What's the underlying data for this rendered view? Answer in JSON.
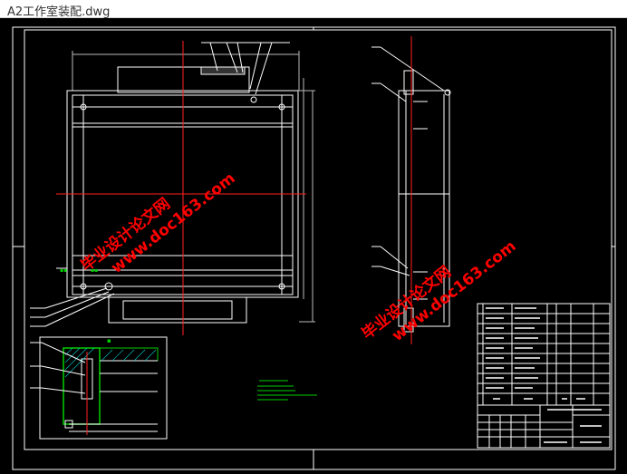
{
  "window": {
    "title": "A2工作室装配.dwg"
  },
  "watermarks": [
    {
      "line1": "毕业设计论文网",
      "line2": "www.doc163.com"
    },
    {
      "line1": "毕业设计论文网",
      "line2": "www.doc163.com"
    }
  ],
  "colors": {
    "background": "#000000",
    "drawing": "#ffffff",
    "centerline": "#ff2020",
    "section": "#00d000",
    "hatch": "#00c8c8",
    "watermark": "#ff0000",
    "titlebar_bg": "#ffffff"
  }
}
